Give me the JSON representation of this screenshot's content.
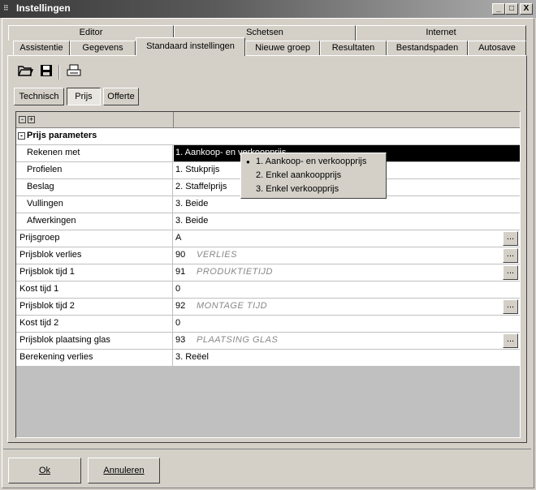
{
  "window": {
    "title": "Instellingen",
    "minimize": "_",
    "maximize": "□",
    "close": "X"
  },
  "tabs": {
    "row1": [
      "Editor",
      "Schetsen",
      "Internet"
    ],
    "row2": [
      "Assistentie",
      "Gegevens",
      "Standaard instellingen",
      "Nieuwe groep",
      "Resultaten",
      "Bestandspaden",
      "Autosave"
    ],
    "active": "Standaard instellingen"
  },
  "toolbar": {
    "icons": [
      "folder-open-icon",
      "save-icon",
      "print-icon"
    ]
  },
  "subtabs": [
    "Technisch",
    "Prijs",
    "Offerte"
  ],
  "grid": {
    "header_expand": "+",
    "header_collapse": "-",
    "section": "Prijs parameters",
    "rows": [
      {
        "label": "Rekenen met",
        "value": "1. Aankoop- en verkoopprijs",
        "indent": true,
        "selected": true
      },
      {
        "label": "Profielen",
        "value": "1. Stukprijs",
        "indent": true
      },
      {
        "label": "Beslag",
        "value": "2. Staffelprijs",
        "indent": true
      },
      {
        "label": "Vullingen",
        "value": "3. Beide",
        "indent": true
      },
      {
        "label": "Afwerkingen",
        "value": "3. Beide",
        "indent": true
      },
      {
        "label": "Prijsgroep",
        "value": "A",
        "ellipsis": true
      },
      {
        "label": "Prijsblok verlies",
        "num": "90",
        "desc": "VERLIES",
        "ellipsis": true
      },
      {
        "label": "Prijsblok tijd 1",
        "num": "91",
        "desc": "PRODUKTIETIJD",
        "ellipsis": true
      },
      {
        "label": "Kost tijd 1",
        "value": "0"
      },
      {
        "label": "Prijsblok tijd 2",
        "num": "92",
        "desc": "MONTAGE TIJD",
        "ellipsis": true
      },
      {
        "label": "Kost tijd 2",
        "value": "0"
      },
      {
        "label": "Prijsblok plaatsing glas",
        "num": "93",
        "desc": "PLAATSING GLAS",
        "ellipsis": true
      },
      {
        "label": "Berekening verlies",
        "value": "3. Reëel"
      }
    ],
    "ellipsis_label": "..."
  },
  "dropdown": {
    "options": [
      "1. Aankoop- en verkoopprijs",
      "2. Enkel aankoopprijs",
      "3. Enkel verkoopprijs"
    ],
    "selected_index": 0,
    "bullet": "●"
  },
  "buttons": {
    "ok": "Ok",
    "cancel": "Annuleren"
  }
}
